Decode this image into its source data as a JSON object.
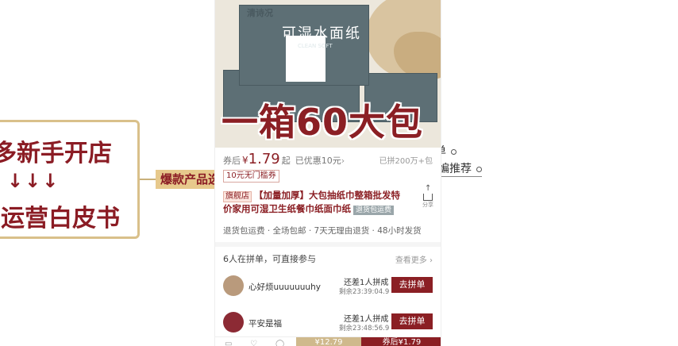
{
  "mindmap": {
    "root_line1": "多新手开店",
    "root_line2": "↓↓↓",
    "root_line3": "运营白皮书",
    "branch_tag": "爆款产品选",
    "right_item1": "单",
    "right_item2": "编推荐"
  },
  "product": {
    "brand": "清诗况",
    "name": "可湿水面纸",
    "name_sub": "CLEAN SOFT",
    "hero_text": "一箱60大包",
    "price_label": "券后",
    "price_symbol": "¥",
    "price_value": "1.79",
    "price_unit": "起",
    "discount_text": "已优惠10元",
    "discount_chevron": "›",
    "sold": "已拼200万+包",
    "coupon": "10元无门槛券",
    "flag": "旗舰店",
    "title": "【加量加厚】大包抽纸巾整箱批发特价家用可湿卫生纸餐巾纸面巾纸",
    "insurance": "退货包运费",
    "share_label": "分享",
    "service": "退货包运费 · 全场包邮 · 7天无理由退货 · 48小时发货"
  },
  "groups": {
    "header": "6人在拼单，可直接参与",
    "more": "查看更多 ›",
    "items": [
      {
        "name": "心好烦uuuuuuuhy",
        "lack": "还差1人拼成",
        "time": "剩余23:39:04.9",
        "button": "去拼单"
      },
      {
        "name": "平安是福",
        "lack": "还差1人拼成",
        "time": "剩余23:48:56.9",
        "button": "去拼单"
      }
    ]
  },
  "bottom_bar": {
    "single_buy": "¥12.79",
    "group_buy": "券后¥1.79"
  },
  "colors": {
    "accent": "#8b1f24",
    "gold": "#cfb98c",
    "pack": "#5d6f75"
  }
}
